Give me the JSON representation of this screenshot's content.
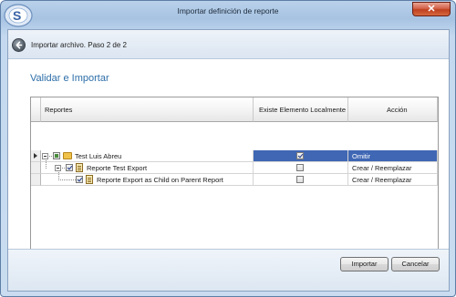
{
  "window": {
    "title": "Importar definición de reporte",
    "close_glyph": "✕"
  },
  "nav": {
    "step_text": "Importar archivo. Paso 2 de 2"
  },
  "section_title": "Validar e Importar",
  "grid": {
    "columns": [
      "Reportes",
      "Existe Elemento Localmente",
      "Acción"
    ],
    "rows": [
      {
        "label": "Test Luis Abreu",
        "icon": "folder-icon",
        "exists": true,
        "action": "Omitir",
        "selected": true,
        "level": 0
      },
      {
        "label": "Reporte Test Export",
        "icon": "report-icon",
        "exists": false,
        "action": "Crear / Reemplazar",
        "selected": false,
        "level": 1
      },
      {
        "label": "Reporte Export as Child on Parent Report",
        "icon": "report-icon",
        "exists": false,
        "action": "Crear / Reemplazar",
        "selected": false,
        "level": 2
      }
    ]
  },
  "buttons": {
    "import_label": "Importar",
    "cancel_label": "Cancelar"
  },
  "colors": {
    "accent": "#2d6ea8",
    "selection": "#3f67b4"
  }
}
